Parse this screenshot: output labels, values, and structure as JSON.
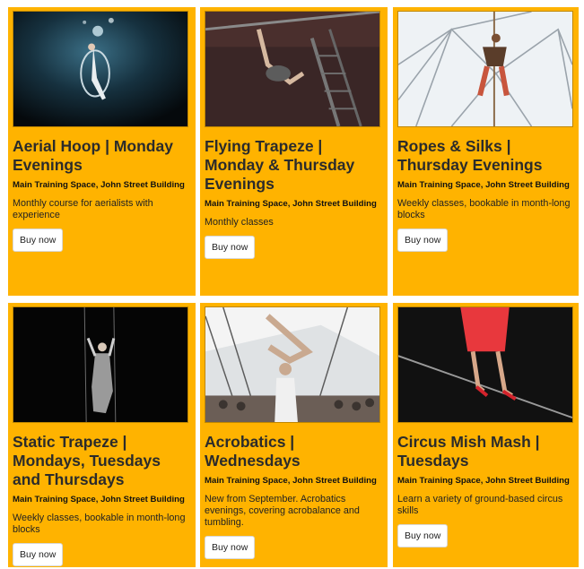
{
  "cards": [
    {
      "title": "Aerial Hoop | Monday Evenings",
      "location": "Main Training Space, John Street Building",
      "description": "Monthly course for aerialists with experience",
      "button": "Buy now",
      "photo": "aerial-hoop-photo"
    },
    {
      "title": "Flying Trapeze | Monday & Thursday Evenings",
      "location": "Main Training Space, John Street Building",
      "description": "Monthly classes",
      "button": "Buy now",
      "photo": "flying-trapeze-photo"
    },
    {
      "title": "Ropes & Silks | Thursday Evenings",
      "location": "Main Training Space, John Street Building",
      "description": "Weekly classes, bookable in month-long blocks",
      "button": "Buy now",
      "photo": "ropes-silks-photo"
    },
    {
      "title": "Static Trapeze | Mondays, Tuesdays and Thursdays",
      "location": "Main Training Space, John Street Building",
      "description": "Weekly classes, bookable in month-long blocks",
      "button": "Buy now",
      "photo": "static-trapeze-photo"
    },
    {
      "title": "Acrobatics | Wednesdays",
      "location": "Main Training Space, John Street Building",
      "description": "New from September. Acrobatics evenings, covering acrobalance and tumbling.",
      "button": "Buy now",
      "photo": "acrobatics-photo"
    },
    {
      "title": "Circus Mish Mash | Tuesdays",
      "location": "Main Training Space, John Street Building",
      "description": "Learn a variety of ground-based circus skills",
      "button": "Buy now",
      "photo": "circus-mish-mash-photo"
    }
  ],
  "colors": {
    "card_background": "#FFB300",
    "title_text": "#2b2b2b"
  }
}
